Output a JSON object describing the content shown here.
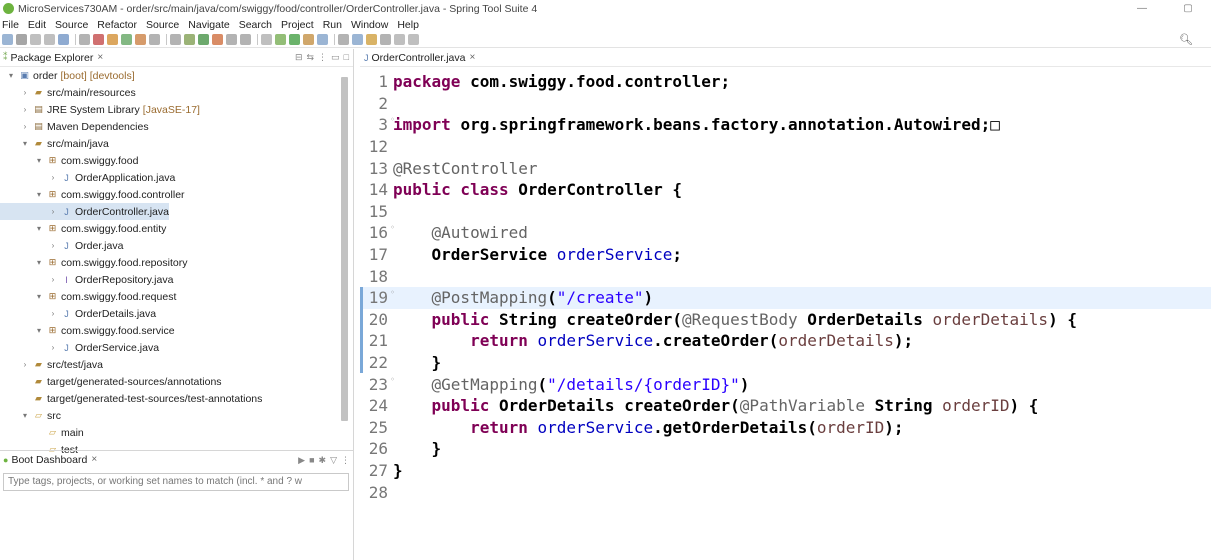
{
  "window": {
    "title": "MicroServices730AM - order/src/main/java/com/swiggy/food/controller/OrderController.java - Spring Tool Suite 4",
    "minimize": "—",
    "restore": "▢"
  },
  "menu": [
    "File",
    "Edit",
    "Source",
    "Refactor",
    "Source",
    "Navigate",
    "Search",
    "Project",
    "Run",
    "Window",
    "Help"
  ],
  "package_explorer": {
    "tab_label": "Package Explorer",
    "close": "×",
    "tree": [
      {
        "label": "order",
        "decoration": "[boot] [devtools]",
        "indent": 0,
        "twisty": "open",
        "icon": "project-icon"
      },
      {
        "label": "src/main/resources",
        "indent": 1,
        "twisty": "closed",
        "icon": "source-folder-icon"
      },
      {
        "label": "JRE System Library",
        "decoration": "[JavaSE-17]",
        "indent": 1,
        "twisty": "closed",
        "icon": "library-icon"
      },
      {
        "label": "Maven Dependencies",
        "indent": 1,
        "twisty": "closed",
        "icon": "library-icon"
      },
      {
        "label": "src/main/java",
        "indent": 1,
        "twisty": "open",
        "icon": "source-folder-icon"
      },
      {
        "label": "com.swiggy.food",
        "indent": 2,
        "twisty": "open",
        "icon": "package-icon"
      },
      {
        "label": "OrderApplication.java",
        "indent": 3,
        "twisty": "closed",
        "icon": "java-file-icon"
      },
      {
        "label": "com.swiggy.food.controller",
        "indent": 2,
        "twisty": "open",
        "icon": "package-icon"
      },
      {
        "label": "OrderController.java",
        "indent": 3,
        "twisty": "closed",
        "icon": "java-file-icon",
        "selected": true
      },
      {
        "label": "com.swiggy.food.entity",
        "indent": 2,
        "twisty": "open",
        "icon": "package-icon"
      },
      {
        "label": "Order.java",
        "indent": 3,
        "twisty": "closed",
        "icon": "java-file-icon"
      },
      {
        "label": "com.swiggy.food.repository",
        "indent": 2,
        "twisty": "open",
        "icon": "package-icon"
      },
      {
        "label": "OrderRepository.java",
        "indent": 3,
        "twisty": "closed",
        "icon": "java-interface-icon"
      },
      {
        "label": "com.swiggy.food.request",
        "indent": 2,
        "twisty": "open",
        "icon": "package-icon"
      },
      {
        "label": "OrderDetails.java",
        "indent": 3,
        "twisty": "closed",
        "icon": "java-file-icon"
      },
      {
        "label": "com.swiggy.food.service",
        "indent": 2,
        "twisty": "open",
        "icon": "package-icon"
      },
      {
        "label": "OrderService.java",
        "indent": 3,
        "twisty": "closed",
        "icon": "java-file-icon"
      },
      {
        "label": "src/test/java",
        "indent": 1,
        "twisty": "closed",
        "icon": "source-folder-icon"
      },
      {
        "label": "target/generated-sources/annotations",
        "indent": 1,
        "twisty": "none",
        "icon": "source-folder-icon"
      },
      {
        "label": "target/generated-test-sources/test-annotations",
        "indent": 1,
        "twisty": "none",
        "icon": "source-folder-icon"
      },
      {
        "label": "src",
        "indent": 1,
        "twisty": "open",
        "icon": "folder-icon"
      },
      {
        "label": "main",
        "indent": 2,
        "twisty": "none",
        "icon": "folder-icon"
      },
      {
        "label": "test",
        "indent": 2,
        "twisty": "none",
        "icon": "folder-icon"
      }
    ]
  },
  "boot_dashboard": {
    "tab_label": "Boot Dashboard",
    "close": "×",
    "filter_placeholder": "Type tags, projects, or working set names to match (incl. * and ? w"
  },
  "editor": {
    "tab_label": "OrderController.java",
    "close": "×",
    "lines": [
      {
        "n": "1",
        "parts": [
          [
            "kw",
            "package "
          ],
          [
            "b",
            "com.swiggy.food.controller;"
          ]
        ]
      },
      {
        "n": "2",
        "parts": []
      },
      {
        "n": "3",
        "fold": true,
        "parts": [
          [
            "kw",
            "import "
          ],
          [
            "b",
            "org.springframework.beans.factory.annotation.Autowired;"
          ],
          [
            "",
            "□"
          ]
        ]
      },
      {
        "n": "12",
        "parts": []
      },
      {
        "n": "13",
        "parts": [
          [
            "ann",
            "@RestController"
          ]
        ]
      },
      {
        "n": "14",
        "parts": [
          [
            "kw",
            "public class "
          ],
          [
            "b",
            "OrderController {"
          ]
        ]
      },
      {
        "n": "15",
        "parts": []
      },
      {
        "n": "16",
        "fold": true,
        "parts": [
          [
            "",
            "    "
          ],
          [
            "ann",
            "@Autowired"
          ]
        ]
      },
      {
        "n": "17",
        "parts": [
          [
            "",
            "    "
          ],
          [
            "b",
            "OrderService "
          ],
          [
            "fld",
            "orderService"
          ],
          [
            "b",
            ";"
          ]
        ]
      },
      {
        "n": "18",
        "parts": []
      },
      {
        "n": "19",
        "fold": true,
        "highlight": true,
        "parts": [
          [
            "",
            "    "
          ],
          [
            "ann",
            "@PostMapping"
          ],
          [
            "b",
            "("
          ],
          [
            "str",
            "\"/create\""
          ],
          [
            "b",
            ")"
          ]
        ]
      },
      {
        "n": "20",
        "parts": [
          [
            "",
            "    "
          ],
          [
            "kw",
            "public "
          ],
          [
            "b",
            "String createOrder("
          ],
          [
            "ann",
            "@RequestBody "
          ],
          [
            "b",
            "OrderDetails "
          ],
          [
            "p",
            "orderDetails"
          ],
          [
            "b",
            ") {"
          ]
        ]
      },
      {
        "n": "21",
        "parts": [
          [
            "",
            "        "
          ],
          [
            "kw",
            "return "
          ],
          [
            "fld",
            "orderService"
          ],
          [
            "b",
            ".createOrder("
          ],
          [
            "p",
            "orderDetails"
          ],
          [
            "b",
            ");"
          ]
        ]
      },
      {
        "n": "22",
        "parts": [
          [
            "",
            "    "
          ],
          [
            "b",
            "}"
          ]
        ]
      },
      {
        "n": "23",
        "fold": true,
        "parts": [
          [
            "",
            "    "
          ],
          [
            "ann",
            "@GetMapping"
          ],
          [
            "b",
            "("
          ],
          [
            "str",
            "\"/details/{orderID}\""
          ],
          [
            "b",
            ")"
          ]
        ]
      },
      {
        "n": "24",
        "parts": [
          [
            "",
            "    "
          ],
          [
            "kw",
            "public "
          ],
          [
            "b",
            "OrderDetails createOrder("
          ],
          [
            "ann",
            "@PathVariable "
          ],
          [
            "b",
            "String "
          ],
          [
            "p",
            "orderID"
          ],
          [
            "b",
            ") {"
          ]
        ]
      },
      {
        "n": "25",
        "parts": [
          [
            "",
            "        "
          ],
          [
            "kw",
            "return "
          ],
          [
            "fld",
            "orderService"
          ],
          [
            "b",
            ".getOrderDetails("
          ],
          [
            "p",
            "orderID"
          ],
          [
            "b",
            ");"
          ]
        ]
      },
      {
        "n": "26",
        "parts": [
          [
            "",
            "    "
          ],
          [
            "b",
            "}"
          ]
        ]
      },
      {
        "n": "27",
        "parts": [
          [
            "b",
            "}"
          ]
        ]
      },
      {
        "n": "28",
        "parts": []
      }
    ]
  },
  "colors": {
    "keyword": "#7f0055",
    "annotation": "#646464",
    "string": "#2a00ff",
    "field": "#0000c0",
    "parameter": "#6a3e3e",
    "selection": "#d7e4f2",
    "current_line": "#e8f2fe"
  }
}
